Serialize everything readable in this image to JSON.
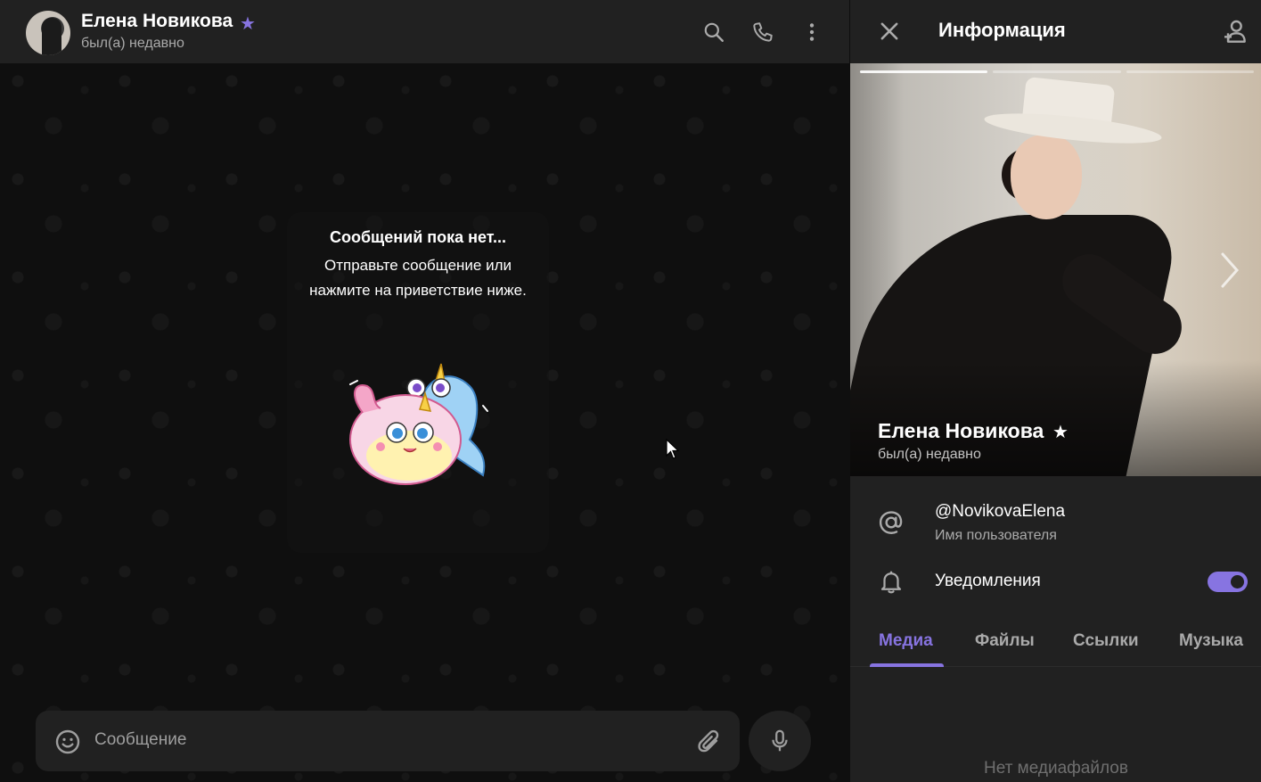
{
  "chat": {
    "peer_name": "Елена Новикова",
    "peer_status": "был(а) недавно",
    "empty_title": "Сообщений пока нет...",
    "empty_text": "Отправьте сообщение или нажмите на приветствие ниже.",
    "composer_placeholder": "Сообщение"
  },
  "info": {
    "title": "Информация",
    "name": "Елена Новикова",
    "status": "был(а) недавно",
    "photo_count": 3,
    "photo_active_index": 0,
    "username": "@NovikovaElena",
    "username_caption": "Имя пользователя",
    "notifications_label": "Уведомления",
    "notifications_enabled": true,
    "tabs": [
      {
        "label": "Медиа",
        "active": true
      },
      {
        "label": "Файлы",
        "active": false
      },
      {
        "label": "Ссылки",
        "active": false
      },
      {
        "label": "Музыка",
        "active": false
      }
    ],
    "empty_media": "Нет медиафайлов"
  },
  "colors": {
    "accent": "#8774e1",
    "background": "#212121",
    "chat_background": "#0f0f0f",
    "secondary_text": "#aaaaaa"
  },
  "icons": [
    "star-icon",
    "search-icon",
    "phone-icon",
    "more-icon",
    "smile-icon",
    "attach-icon",
    "mic-icon",
    "close-icon",
    "add-contact-icon",
    "chevron-right-icon",
    "at-icon",
    "bell-icon",
    "cursor-icon"
  ]
}
